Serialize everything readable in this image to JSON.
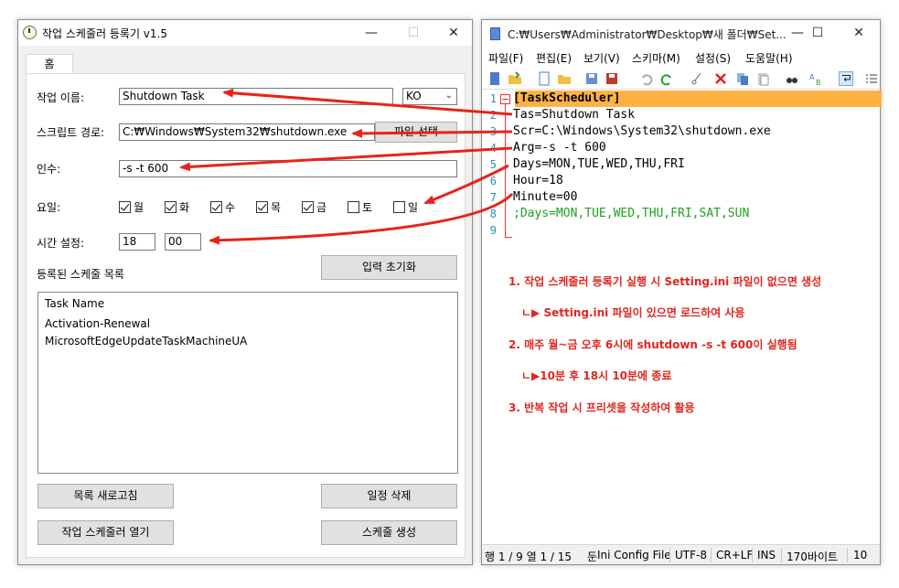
{
  "left_window": {
    "title": "작업 스케줄러 등록기 v1.5",
    "minimize": "—",
    "maximize": "☐",
    "close": "✕",
    "tab_home": "홈",
    "task_name_label": "작업 이름:",
    "task_name_value": "Shutdown Task",
    "lang_value": "KO",
    "script_path_label": "스크립트 경로:",
    "script_path_value": "C:₩Windows₩System32₩shutdown.exe",
    "file_select_button": "파일 선택",
    "args_label": "인수:",
    "args_value": "-s -t 600",
    "days_label": "요일:",
    "days": [
      {
        "label": "월",
        "checked": true
      },
      {
        "label": "화",
        "checked": true
      },
      {
        "label": "수",
        "checked": true
      },
      {
        "label": "목",
        "checked": true
      },
      {
        "label": "금",
        "checked": true
      },
      {
        "label": "토",
        "checked": false
      },
      {
        "label": "일",
        "checked": false
      }
    ],
    "time_label": "시간 설정:",
    "hour_value": "18",
    "minute_value": "00",
    "reset_button": "입력 초기화",
    "registered_label": "등록된 스케줄 목록",
    "list_header": "Task Name",
    "list_items": [
      "Activation-Renewal",
      "MicrosoftEdgeUpdateTaskMachineUA"
    ],
    "refresh_button": "목록 새로고침",
    "delete_button": "일정 삭제",
    "open_scheduler_button": "작업 스케줄러 열기",
    "create_button": "스케줄 생성"
  },
  "right_window": {
    "title": "C:₩Users₩Administrator₩Desktop₩새 폴더₩Set...",
    "minimize": "—",
    "maximize": "☐",
    "close": "✕",
    "menus": [
      "파일(F)",
      "편집(E)",
      "보기(V)",
      "스키마(M)",
      "설정(S)",
      "도움말(H)"
    ],
    "line_numbers": [
      "1",
      "2",
      "3",
      "4",
      "5",
      "6",
      "7",
      "8",
      "9"
    ],
    "code_lines": [
      "[TaskScheduler]",
      "Tas=Shutdown Task",
      "Scr=C:\\Windows\\System32\\shutdown.exe",
      "Arg=-s -t 600",
      "Days=MON,TUE,WED,THU,FRI",
      "Hour=18",
      "Minute=00",
      ";Days=MON,TUE,WED,THU,FRI,SAT,SUN",
      ""
    ],
    "notes": [
      "1. 작업 스케줄러 등록기 실행 시 Setting.ini 파일이 없으면 생성",
      "ㄴ▶ Setting.ini 파일이 있으면 로드하여 사용",
      "2. 매주 월~금 오후 6시에 shutdown -s -t 600이 실행됨",
      "ㄴ▶10분 후 18시 10분에 종료",
      "3. 반복 작업 시 프리셋을 작성하여 활용"
    ],
    "status": {
      "position": "행 1 / 9 열 1 / 15",
      "col_char": "둔",
      "schema": "Ini Config File",
      "encoding": "UTF-8",
      "eol": "CR+LF",
      "mode": "INS",
      "size": "170바이트",
      "zoom": "10"
    }
  },
  "colors": {
    "arrow": "#e8231b",
    "current_line": "#ffb244",
    "comment": "#1ba31b",
    "note_text": "#e0261e",
    "line_number": "#2b91af"
  }
}
